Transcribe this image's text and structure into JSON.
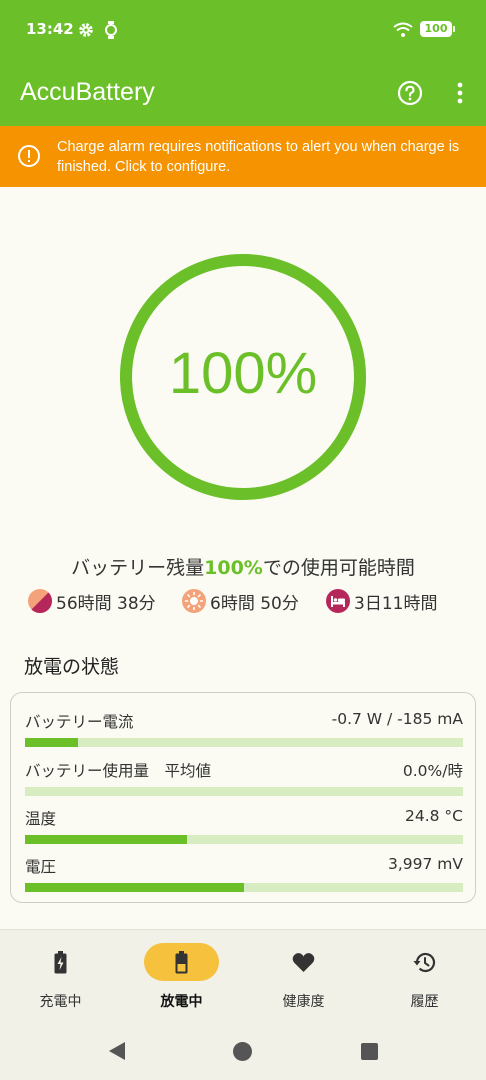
{
  "status_bar": {
    "time": "13:42",
    "battery_level": "100",
    "icons": [
      "gear-icon",
      "watch-icon",
      "wifi-icon",
      "battery-icon"
    ]
  },
  "app_bar": {
    "title": "AccuBattery",
    "actions": [
      "help-icon",
      "more-vert-icon"
    ]
  },
  "alert": {
    "text": "Charge alarm requires notifications to alert you when charge is finished. Click to configure.",
    "icon": "alert-circle-icon",
    "color": "#f59300"
  },
  "gauge": {
    "percent_label": "100%",
    "level": 1.0
  },
  "estimate": {
    "title_prefix": "バッテリー残量",
    "title_highlight": "100%",
    "title_suffix": "での使用可能時間",
    "items": [
      {
        "icon": "screen-on-off-icon",
        "value": "56時間 38分"
      },
      {
        "icon": "screen-on-icon",
        "value": "6時間 50分"
      },
      {
        "icon": "sleep-icon",
        "value": "3日11時間"
      }
    ]
  },
  "discharge": {
    "title": "放電の状態",
    "rows": [
      {
        "label": "バッテリー電流",
        "value": "-0.7 W / -185 mA",
        "level": 0.12
      },
      {
        "label": "バッテリー使用量　平均値",
        "value": "0.0%/時",
        "level": 0.0
      },
      {
        "label": "温度",
        "value": "24.8 °C",
        "level": 0.37
      },
      {
        "label": "電圧",
        "value": "3,997 mV",
        "level": 0.5
      }
    ]
  },
  "bottom_nav": {
    "items": [
      {
        "label": "充電中",
        "icon": "battery-charging-icon",
        "active": false
      },
      {
        "label": "放電中",
        "icon": "battery-discharging-icon",
        "active": true
      },
      {
        "label": "健康度",
        "icon": "heart-icon",
        "active": false
      },
      {
        "label": "履歴",
        "icon": "history-icon",
        "active": false
      }
    ]
  },
  "system_nav": [
    "back-icon",
    "home-icon",
    "recents-icon"
  ],
  "colors": {
    "accent": "#6bbf28",
    "accent_light": "#d8ecc2",
    "active_pill": "#f6c13d",
    "background": "#fbfbf3"
  }
}
